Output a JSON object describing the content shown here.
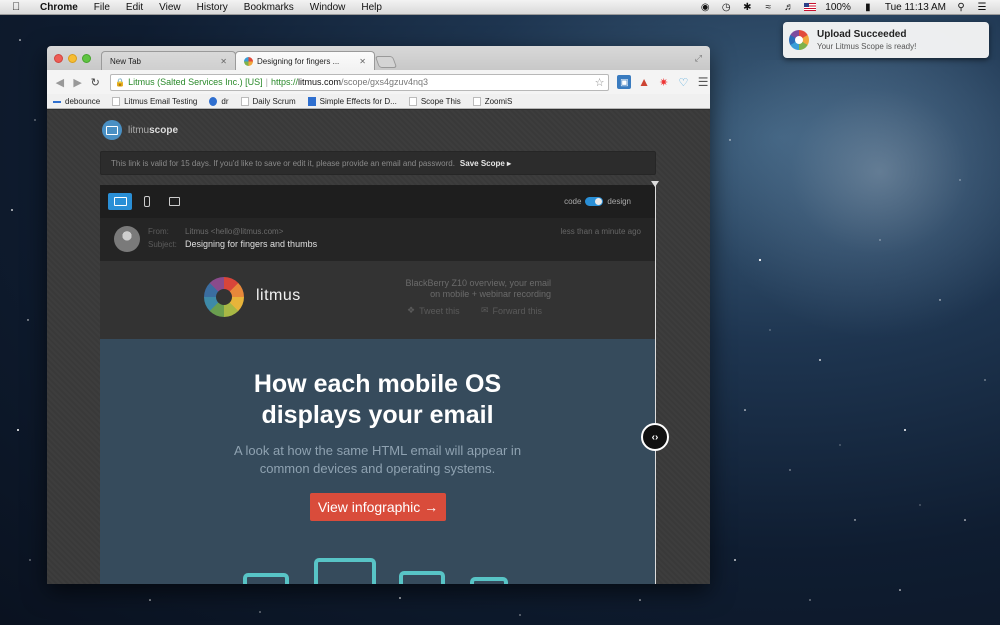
{
  "menubar": {
    "app_name": "Chrome",
    "items": [
      "File",
      "Edit",
      "View",
      "History",
      "Bookmarks",
      "Window",
      "Help"
    ],
    "battery": "100%",
    "clock": "Tue 11:13 AM"
  },
  "notification": {
    "title": "Upload Succeeded",
    "message": "Your Litmus Scope is ready!"
  },
  "browser": {
    "tabs": [
      {
        "label": "New Tab"
      },
      {
        "label": "Designing for fingers ..."
      }
    ],
    "omnibox": {
      "ev_label": "Litmus (Salted Services Inc.) [US]",
      "scheme": "https://",
      "host": "litmus.com",
      "path": "/scope/gxs4gzuv4nq3"
    },
    "bookmarks": [
      "debounce",
      "Litmus Email Testing",
      "dr",
      "Daily Scrum",
      "Simple Effects for D...",
      "Scope This",
      "ZoomiS"
    ]
  },
  "page": {
    "brand": {
      "prefix": "litmu",
      "suffix": "scope"
    },
    "infobar": {
      "text": "This link is valid for 15 days. If you'd like to save or edit it, please provide an email and password.",
      "save_label": "Save Scope ▸"
    },
    "viewer": {
      "toggle_left": "code",
      "toggle_right": "design"
    },
    "email_meta": {
      "from_label": "From:",
      "from_value": "Litmus <hello@litmus.com>",
      "subject_label": "Subject:",
      "subject_value": "Designing for fingers and thumbs",
      "time": "less than a minute ago"
    },
    "email": {
      "logo_word": "litmus",
      "preheader_line1": "BlackBerry Z10 overview, your email",
      "preheader_line2": "on mobile + webinar recording",
      "tweet_label": "Tweet this",
      "forward_label": "Forward this",
      "hero_title_line1": "How each mobile OS",
      "hero_title_line2": "displays your email",
      "hero_sub_line1": "A look at how the same HTML email will appear in",
      "hero_sub_line2": "common devices and operating systems.",
      "cta_label": "View infographic →"
    }
  }
}
